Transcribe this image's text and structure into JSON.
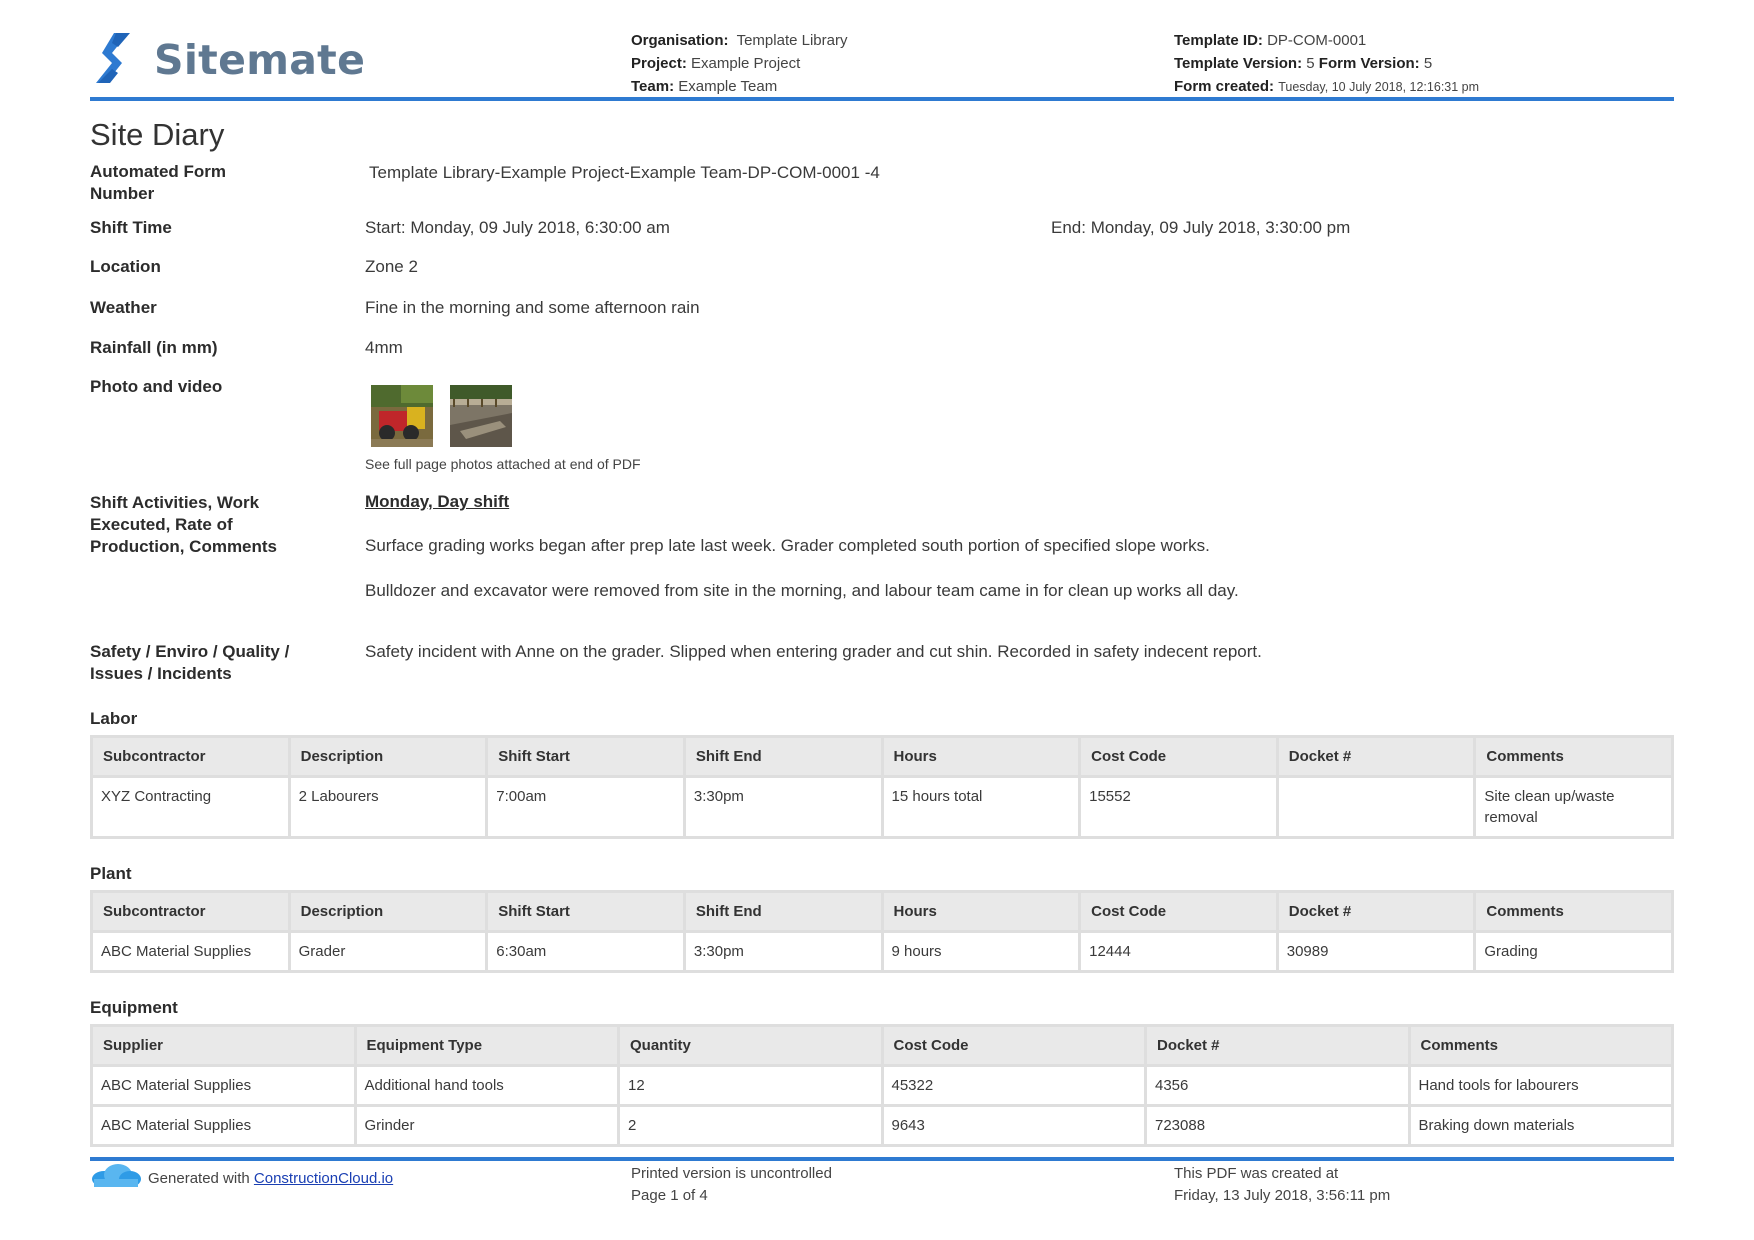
{
  "header": {
    "brand": "Sitemate",
    "organisation_label": "Organisation:",
    "organisation_value": "Template Library",
    "project_label": "Project:",
    "project_value": "Example Project",
    "team_label": "Team:",
    "team_value": "Example Team",
    "template_id_label": "Template ID:",
    "template_id_value": "DP-COM-0001",
    "template_version_label": "Template Version:",
    "template_version_value": "5",
    "form_version_label": "Form Version:",
    "form_version_value": "5",
    "form_created_label": "Form created:",
    "form_created_value": "Tuesday, 10 July 2018, 12:16:31 pm",
    "accent_color": "#2e7ad1"
  },
  "form": {
    "title": "Site Diary",
    "fields": {
      "automated_form_number_label": "Automated Form Number",
      "automated_form_number_value": "Template Library-Example Project-Example Team-DP-COM-0001   -4",
      "shift_time_label": "Shift Time",
      "shift_start": "Start: Monday, 09 July 2018, 6:30:00 am",
      "shift_end": "End: Monday, 09 July 2018, 3:30:00 pm",
      "location_label": "Location",
      "location_value": "Zone 2",
      "weather_label": "Weather",
      "weather_value": "Fine in the morning and some afternoon rain",
      "rainfall_label": "Rainfall (in mm)",
      "rainfall_value": "4mm",
      "photo_label": "Photo and video",
      "photo_caption": "See full page photos attached at end of PDF",
      "activities_label": "Shift Activities, Work Executed, Rate of Production, Comments",
      "activities_heading": "Monday, Day shift",
      "activities_p1": "Surface grading works began after prep late last week. Grader completed south portion of specified slope works.",
      "activities_p2": "Bulldozer and excavator were removed from site in the morning, and labour team came in for clean up works all day.",
      "safety_label": "Safety / Enviro / Quality / Issues / Incidents",
      "safety_value": "Safety incident with Anne on the grader. Slipped when entering grader and cut shin. Recorded in safety indecent report."
    }
  },
  "labor": {
    "title": "Labor",
    "headers": [
      "Subcontractor",
      "Description",
      "Shift Start",
      "Shift End",
      "Hours",
      "Cost Code",
      "Docket #",
      "Comments"
    ],
    "rows": [
      [
        "XYZ Contracting",
        "2 Labourers",
        "7:00am",
        "3:30pm",
        "15 hours total",
        "15552",
        "",
        "Site clean up/waste removal"
      ]
    ]
  },
  "plant": {
    "title": "Plant",
    "headers": [
      "Subcontractor",
      "Description",
      "Shift Start",
      "Shift End",
      "Hours",
      "Cost Code",
      "Docket #",
      "Comments"
    ],
    "rows": [
      [
        "ABC Material Supplies",
        "Grader",
        "6:30am",
        "3:30pm",
        "9 hours",
        "12444",
        "30989",
        "Grading"
      ]
    ]
  },
  "equipment": {
    "title": "Equipment",
    "headers": [
      "Supplier",
      "Equipment Type",
      "Quantity",
      "Cost Code",
      "Docket #",
      "Comments"
    ],
    "rows": [
      [
        "ABC Material Supplies",
        "Additional hand tools",
        "12",
        "45322",
        "4356",
        "Hand tools for labourers"
      ],
      [
        "ABC Material Supplies",
        "Grinder",
        "2",
        "9643",
        "723088",
        "Braking down materials"
      ]
    ]
  },
  "footer": {
    "generated_prefix": "Generated with",
    "generated_link": "ConstructionCloud.io",
    "uncontrolled": "Printed version is uncontrolled",
    "page": "Page 1 of 4",
    "created_line1": "This PDF was created at",
    "created_line2": "Friday, 13 July 2018, 3:56:11 pm"
  }
}
